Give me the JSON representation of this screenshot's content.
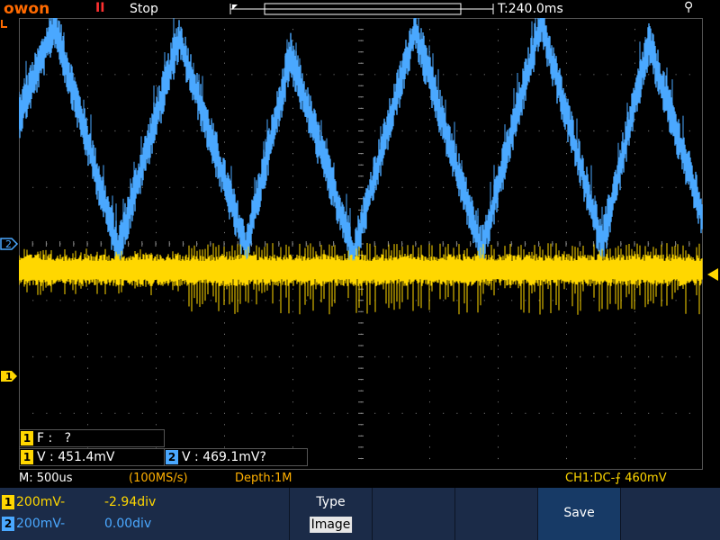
{
  "header": {
    "brand": "owon",
    "pause_glyph": "II",
    "run_state": "Stop",
    "timebase_position": "T:240.0ms",
    "usb_glyph": "⚲"
  },
  "channel_markers": {
    "ch2_label": "2",
    "ch1_label": "1"
  },
  "measurements": {
    "ch1_freq": {
      "channel": "1",
      "label": "F :",
      "value": "?"
    },
    "ch1_vpp": {
      "channel": "1",
      "label": "V :",
      "value": "451.4mV"
    },
    "ch2_vpp": {
      "channel": "2",
      "label": "V :",
      "value": "469.1mV?"
    }
  },
  "status_bar": {
    "timebase": "M: 500us",
    "sample_rate": "(100MS/s)",
    "depth": "Depth:1M",
    "trigger": "CH1:DC-",
    "trigger_glyph": "⨍",
    "trigger_level": "460mV"
  },
  "bottom_bar": {
    "ch1": {
      "index": "1",
      "scale": "200mV-",
      "offset": "-2.94div"
    },
    "ch2": {
      "index": "2",
      "scale": "200mV-",
      "offset": "0.00div"
    },
    "type_label": "Type",
    "type_value": "Image",
    "save_label": "Save"
  },
  "colors": {
    "ch1": "#ffd700",
    "ch2": "#4aa8ff",
    "brand": "#ff6a00",
    "panel": "#1b2b48",
    "save_highlight": "#173a66"
  }
}
